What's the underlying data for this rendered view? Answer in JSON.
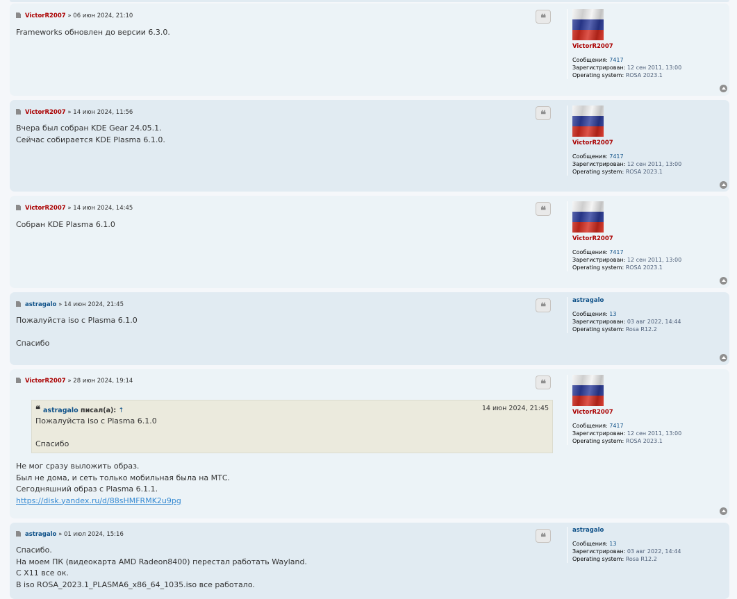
{
  "posts": [
    {
      "author": "VictorR2007",
      "separator": "»",
      "date": "06 июн 2024, 21:10",
      "lines": [
        "Frameworks обновлен до версии 6.3.0."
      ],
      "profile": {
        "name": "VictorR2007",
        "posts_label": "Сообщения:",
        "posts": "7417",
        "reg_label": "Зарегистрирован:",
        "reg": "12 сен 2011, 13:00",
        "os_label": "Operating system:",
        "os": "ROSA 2023.1"
      }
    },
    {
      "author": "VictorR2007",
      "separator": "»",
      "date": "14 июн 2024, 11:56",
      "lines": [
        "Вчера был собран KDE Gear 24.05.1.",
        "Сейчас собирается KDE Plasma 6.1.0."
      ],
      "profile": {
        "name": "VictorR2007",
        "posts_label": "Сообщения:",
        "posts": "7417",
        "reg_label": "Зарегистрирован:",
        "reg": "12 сен 2011, 13:00",
        "os_label": "Operating system:",
        "os": "ROSA 2023.1"
      }
    },
    {
      "author": "VictorR2007",
      "separator": "»",
      "date": "14 июн 2024, 14:45",
      "lines": [
        "Собран KDE Plasma 6.1.0"
      ],
      "profile": {
        "name": "VictorR2007",
        "posts_label": "Сообщения:",
        "posts": "7417",
        "reg_label": "Зарегистрирован:",
        "reg": "12 сен 2011, 13:00",
        "os_label": "Operating system:",
        "os": "ROSA 2023.1"
      }
    },
    {
      "author": "astragalo",
      "separator": "»",
      "date": "14 июн 2024, 21:45",
      "lines": [
        "Пожалуйста iso с Plasma 6.1.0",
        "",
        "Спасибо"
      ],
      "profile": {
        "name": "astragalo",
        "posts_label": "Сообщения:",
        "posts": "13",
        "reg_label": "Зарегистрирован:",
        "reg": "03 авг 2022, 14:44",
        "os_label": "Operating system:",
        "os": "Rosa R12.2"
      }
    },
    {
      "author": "VictorR2007",
      "separator": "»",
      "date": "28 июн 2024, 19:14",
      "quote": {
        "author": "astragalo",
        "wrote": "писал(а):",
        "arrow": "↑",
        "date": "14 июн 2024, 21:45",
        "lines": [
          "Пожалуйста iso с Plasma 6.1.0",
          "",
          "Спасибо"
        ]
      },
      "lines": [
        "Не мог сразу выложить образ.",
        "Был не дома, и сеть только мобильная была на МТС.",
        "Сегодняшний образ с Plasma 6.1.1."
      ],
      "link": "https://disk.yandex.ru/d/88sHMFRMK2u9pg",
      "profile": {
        "name": "VictorR2007",
        "posts_label": "Сообщения:",
        "posts": "7417",
        "reg_label": "Зарегистрирован:",
        "reg": "12 сен 2011, 13:00",
        "os_label": "Operating system:",
        "os": "ROSA 2023.1"
      }
    },
    {
      "author": "astragalo",
      "separator": "»",
      "date": "01 июл 2024, 15:16",
      "lines": [
        "Спасибо.",
        "На моем ПК (видеокарта AMD Radeon8400) перестал работать Wayland.",
        "С X11 все ок.",
        "В iso ROSA_2023.1_PLASMA6_x86_64_1035.iso все работало."
      ],
      "profile": {
        "name": "astragalo",
        "posts_label": "Сообщения:",
        "posts": "13",
        "reg_label": "Зарегистрирован:",
        "reg": "03 авг 2022, 14:44",
        "os_label": "Operating system:",
        "os": "Rosa R12.2"
      }
    }
  ],
  "icons": {
    "post": "post-doc-icon",
    "quote": "quote-icon",
    "top": "back-to-top-icon"
  },
  "colors": {
    "bg1": "#ecf3f7",
    "bg2": "#e1ebf2",
    "author_red": "#aa0000",
    "author_blue": "#105289",
    "quote_bg": "#ebeadd"
  }
}
